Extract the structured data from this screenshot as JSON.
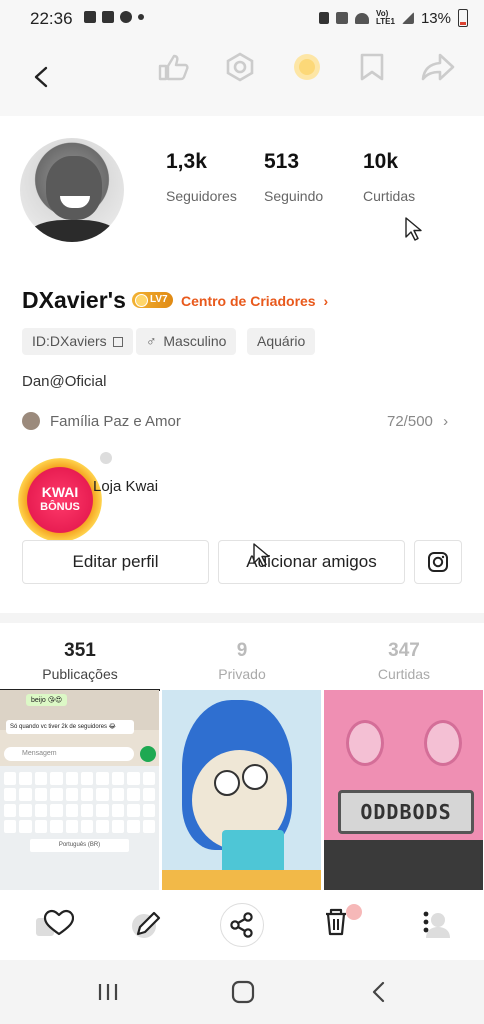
{
  "status_bar": {
    "time": "22:36",
    "battery": "13%"
  },
  "profile": {
    "name": "DXavier's",
    "level": "LV7",
    "creator_center": "Centro de Criadores",
    "stats": [
      {
        "value": "1,3k",
        "label": "Seguidores"
      },
      {
        "value": "513",
        "label": "Seguindo"
      },
      {
        "value": "10k",
        "label": "Curtidas"
      }
    ],
    "tags": [
      "ID:DXaviers",
      "Masculino",
      "Aquário"
    ],
    "bio": "Dan@Oficial",
    "family": {
      "name": "Família Paz e Amor",
      "count": "72/500"
    },
    "shop": {
      "badge_line1": "KWAI",
      "badge_line2": "BÔNUS",
      "label": "Loja Kwai"
    }
  },
  "buttons": {
    "edit": "Editar perfil",
    "add_friends": "Adicionar amigos"
  },
  "tabs": [
    {
      "count": "351",
      "label": "Publicações"
    },
    {
      "count": "9",
      "label": "Privado"
    },
    {
      "count": "347",
      "label": "Curtidas"
    }
  ],
  "thumbs": {
    "chat_bubble_1": "beijo 😘😍",
    "chat_bubble_2": "Só quando vc tiver 2k de seguidores 😂",
    "message_placeholder": "Mensagem",
    "keyboard_lang": "Português (BR)",
    "plate": "ODDBODS"
  },
  "colors": {
    "accent": "#e8591c",
    "badge": "#e08a14"
  }
}
